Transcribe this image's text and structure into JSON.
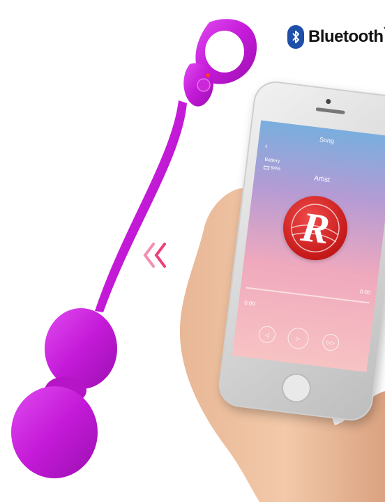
{
  "brand": {
    "bluetooth_label": "Bluetooth",
    "bluetooth_tm": "™",
    "bluetooth_color": "#1f4fa8"
  },
  "product": {
    "color": "#c41ad8",
    "indicator_color": "#ff3b30"
  },
  "phone_app": {
    "screen_title": "Song",
    "back_icon": "chevron-left-icon",
    "back_glyph": "‹",
    "menu_glyph": "≡",
    "battery_label": "Battery",
    "battery_value": "94%",
    "artist": "Artist",
    "time_elapsed": "0:00",
    "time_total": "0:00",
    "progress": 0,
    "logo_letter": "R",
    "prev_glyph": "◁",
    "play_glyph": "▷",
    "next_glyph": "▷▷",
    "logo_color": "#d11f1f"
  }
}
